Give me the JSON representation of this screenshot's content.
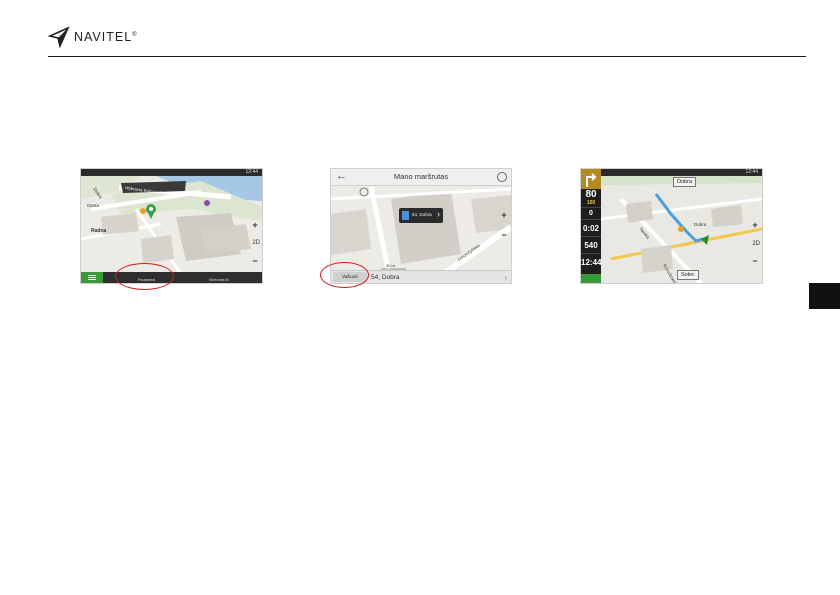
{
  "header": {
    "brand": "NAVITEL",
    "mark": "®"
  },
  "screenshots": [
    {
      "map_labels": [
        "Wybrzeże Kościuszkowskie",
        "Dobra",
        "Gęsta",
        "Radna"
      ],
      "bottom_buttons": [
        "Parametrai",
        "Maršrutas iki"
      ],
      "zoom_in": "+",
      "zoom_out": "−",
      "mode": "2D",
      "highlight": "Parametrai button"
    },
    {
      "title": "Mano maršrutas",
      "popup_address": "54, Dobra",
      "address": "54, Dobra",
      "go_button": "Važiuoti",
      "street": "Leszczyńska",
      "scale": "30 m",
      "zoom_in": "+",
      "zoom_out": "−",
      "highlight": "Važiuoti button"
    },
    {
      "speed": "80",
      "speed_unit": "km/h",
      "speed_limit": "100",
      "dist_small": "0",
      "time_left": "0:02",
      "distance": "540",
      "distance_unit": "m",
      "clock": "12:44",
      "callouts": [
        "Dobra",
        "Sołec"
      ],
      "streets": [
        "Tamka",
        "Kruczkowskiego",
        "Dobra"
      ],
      "zoom_in": "+",
      "zoom_out": "−",
      "mode": "2D"
    }
  ]
}
